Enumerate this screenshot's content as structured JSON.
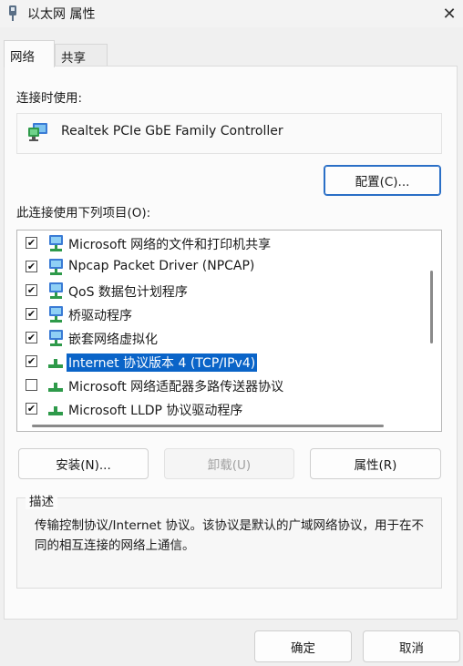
{
  "window": {
    "title": "以太网 属性",
    "close_symbol": "✕"
  },
  "tabs": [
    {
      "label": "网络",
      "active": true
    },
    {
      "label": "共享",
      "active": false
    }
  ],
  "connect_using": {
    "label": "连接时使用:",
    "adapter_name": "Realtek PCIe GbE Family Controller",
    "configure_button": "配置(C)..."
  },
  "items_section": {
    "label": "此连接使用下列项目(O):",
    "items": [
      {
        "label": "Microsoft 网络的文件和打印机共享",
        "checked": true,
        "icon": "network-client-icon",
        "selected": false
      },
      {
        "label": "Npcap Packet Driver (NPCAP)",
        "checked": true,
        "icon": "network-client-icon",
        "selected": false
      },
      {
        "label": "QoS 数据包计划程序",
        "checked": true,
        "icon": "network-client-icon",
        "selected": false
      },
      {
        "label": "桥驱动程序",
        "checked": true,
        "icon": "network-client-icon",
        "selected": false
      },
      {
        "label": "嵌套网络虚拟化",
        "checked": true,
        "icon": "network-client-icon",
        "selected": false
      },
      {
        "label": "Internet 协议版本 4 (TCP/IPv4)",
        "checked": true,
        "icon": "protocol-icon",
        "selected": true
      },
      {
        "label": "Microsoft 网络适配器多路传送器协议",
        "checked": false,
        "icon": "protocol-icon",
        "selected": false
      },
      {
        "label": "Microsoft LLDP 协议驱动程序",
        "checked": true,
        "icon": "protocol-icon",
        "selected": false
      }
    ]
  },
  "actions": {
    "install": "安装(N)...",
    "uninstall": "卸载(U)",
    "properties": "属性(R)"
  },
  "description": {
    "title": "描述",
    "text": "传输控制协议/Internet 协议。该协议是默认的广域网络协议，用于在不同的相互连接的网络上通信。"
  },
  "footer": {
    "ok": "确定",
    "cancel": "取消"
  },
  "colors": {
    "selection": "#0a64c8",
    "accent_border": "#2a6fc6"
  }
}
